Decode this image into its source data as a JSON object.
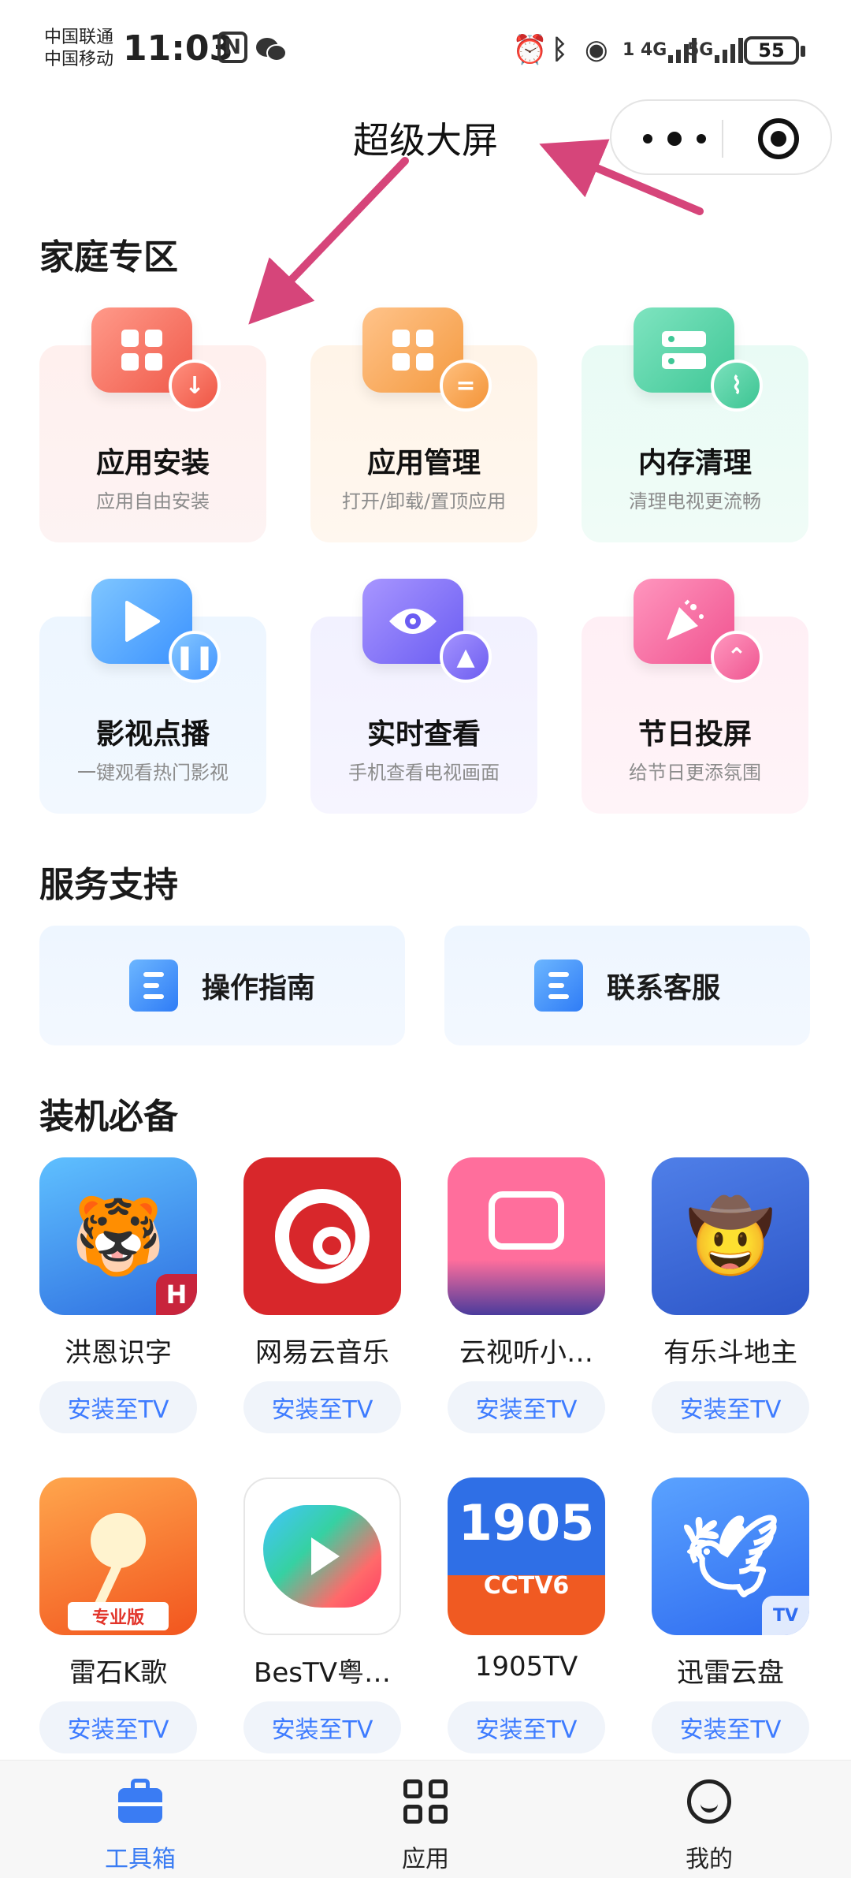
{
  "status_bar": {
    "carrier_1": "中国联通",
    "carrier_2": "中国移动",
    "time": "11:03",
    "nfc_glyph": "N",
    "net_4g": "1 4G",
    "net_5g": "5G",
    "battery": "55"
  },
  "header": {
    "title": "超级大屏"
  },
  "home_section": {
    "title": "家庭专区",
    "cards": [
      {
        "label": "应用安装",
        "sub": "应用自由安装",
        "icon": "apps-install-icon",
        "color": "#f05a4a"
      },
      {
        "label": "应用管理",
        "sub": "打开/卸载/置顶应用",
        "icon": "apps-manage-icon",
        "color": "#f49a40"
      },
      {
        "label": "内存清理",
        "sub": "清理电视更流畅",
        "icon": "memory-clean-icon",
        "color": "#3fc796"
      },
      {
        "label": "影视点播",
        "sub": "一键观看热门影视",
        "icon": "video-play-icon",
        "color": "#3b92ff"
      },
      {
        "label": "实时查看",
        "sub": "手机查看电视画面",
        "icon": "eye-view-icon",
        "color": "#6a5cf2"
      },
      {
        "label": "节日投屏",
        "sub": "给节日更添氛围",
        "icon": "festival-cast-icon",
        "color": "#f0528f"
      }
    ]
  },
  "service_section": {
    "title": "服务支持",
    "items": [
      {
        "label": "操作指南",
        "icon": "guide-doc-icon"
      },
      {
        "label": "联系客服",
        "icon": "customer-service-icon"
      }
    ]
  },
  "apps_section": {
    "title": "装机必备",
    "install_label": "安装至TV",
    "apps": [
      {
        "name": "洪恩识字"
      },
      {
        "name": "网易云音乐"
      },
      {
        "name": "云视听小…"
      },
      {
        "name": "有乐斗地主"
      },
      {
        "name": "雷石K歌",
        "tag": "专业版"
      },
      {
        "name": "BesTV粤…"
      },
      {
        "name": "1905TV",
        "logo_top": "1905",
        "logo_bottom": "CCTV6"
      },
      {
        "name": "迅雷云盘",
        "tag": "TV"
      }
    ]
  },
  "tab_bar": {
    "tabs": [
      {
        "label": "工具箱",
        "active": true
      },
      {
        "label": "应用",
        "active": false
      },
      {
        "label": "我的",
        "active": false
      }
    ]
  },
  "colors": {
    "accent": "#3a7cf3",
    "install_text": "#3d7bff",
    "annotation_arrow": "#d6457a"
  }
}
